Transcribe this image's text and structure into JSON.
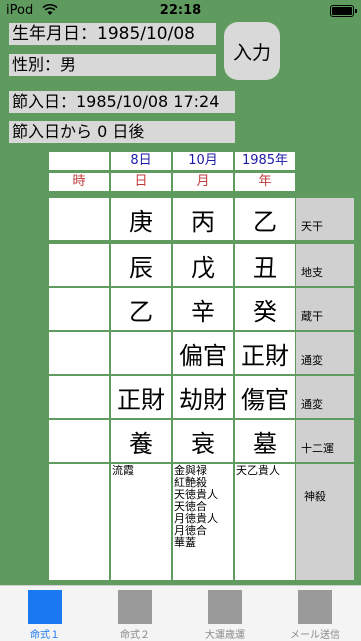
{
  "status_bar": {
    "carrier": "iPod",
    "time": "22:18"
  },
  "profile": {
    "birth": "生年月日：1985/10/08",
    "gender": "性別：男",
    "setsu_date": "節入日：1985/10/08 17:24",
    "days_after": "節入日から 0 日後"
  },
  "input_button": "入力",
  "header": {
    "date_values": [
      "8日",
      "10月",
      "1985年"
    ],
    "pillars": [
      "時",
      "日",
      "月",
      "年"
    ]
  },
  "rows": [
    {
      "cells": [
        "",
        "庚",
        "丙",
        "乙"
      ],
      "label": "天干"
    },
    {
      "cells": [
        "",
        "辰",
        "戊",
        "丑"
      ],
      "label": "地支"
    },
    {
      "cells": [
        "",
        "乙",
        "辛",
        "癸"
      ],
      "label": "蔵干"
    },
    {
      "cells": [
        "",
        "",
        "偏官",
        "正財"
      ],
      "label": "通変"
    },
    {
      "cells": [
        "",
        "正財",
        "劫財",
        "傷官"
      ],
      "label": "通変"
    },
    {
      "cells": [
        "",
        "養",
        "衰",
        "墓"
      ],
      "label": "十二運"
    }
  ],
  "shinsatsu": {
    "label": "神殺",
    "cells": [
      "",
      "流霞",
      "金與禄\n紅艶殺\n天徳貴人\n天徳合\n月徳貴人\n月徳合\n華蓋",
      "天乙貴人"
    ]
  },
  "tabs": [
    {
      "label": "命式１",
      "active": true
    },
    {
      "label": "命式２",
      "active": false
    },
    {
      "label": "大運歳運",
      "active": false
    },
    {
      "label": "メール送信",
      "active": false
    }
  ],
  "colors": {
    "background": "#5f9a5f",
    "active_tab": "#1a78f0",
    "date_text": "#1b1ba6",
    "pillar_text": "#c23a3a"
  }
}
